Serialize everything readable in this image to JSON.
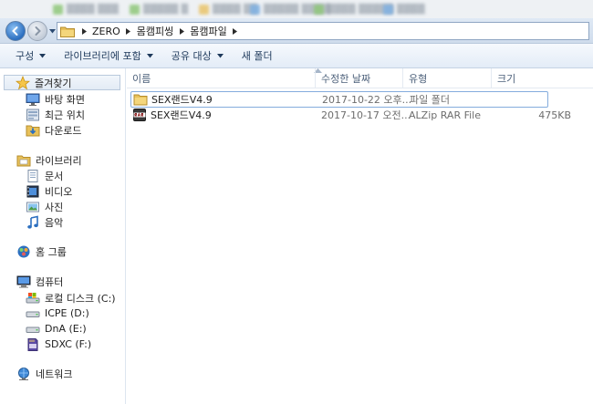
{
  "window": {
    "breadcrumb": [
      "ZERO",
      "몸캠피씽",
      "몸캠파일"
    ]
  },
  "toolbar": {
    "organize": "구성",
    "include_in_library": "라이브러리에 포함",
    "share_with": "공유 대상",
    "new_folder": "새 폴더"
  },
  "sidebar": {
    "favorites": {
      "header": "즐겨찾기",
      "items": [
        {
          "label": "바탕 화면",
          "icon": "desktop-icon"
        },
        {
          "label": "최근 위치",
          "icon": "recent-places-icon"
        },
        {
          "label": "다운로드",
          "icon": "downloads-icon"
        }
      ]
    },
    "libraries": {
      "header": "라이브러리",
      "items": [
        {
          "label": "문서",
          "icon": "documents-icon"
        },
        {
          "label": "비디오",
          "icon": "videos-icon"
        },
        {
          "label": "사진",
          "icon": "pictures-icon"
        },
        {
          "label": "음악",
          "icon": "music-icon"
        }
      ]
    },
    "homegroup": {
      "header": "홈 그룹"
    },
    "computer": {
      "header": "컴퓨터",
      "items": [
        {
          "label": "로컬 디스크 (C:)",
          "icon": "local-disk-icon"
        },
        {
          "label": "ICPE (D:)",
          "icon": "drive-icon"
        },
        {
          "label": "DnA (E:)",
          "icon": "drive-icon"
        },
        {
          "label": "SDXC (F:)",
          "icon": "sd-card-icon"
        }
      ]
    },
    "network": {
      "header": "네트워크"
    }
  },
  "columns": {
    "name": "이름",
    "date_modified": "수정한 날짜",
    "type": "유형",
    "size": "크기"
  },
  "files": [
    {
      "name": "SEX랜드V4.9",
      "date": "2017-10-22 오후...",
      "type": "파일 폴더",
      "size": "",
      "icon": "folder-icon"
    },
    {
      "name": "SEX랜드V4.9",
      "date": "2017-10-17 오전...",
      "type": "ALZip RAR File",
      "size": "475KB",
      "icon": "rar-archive-icon"
    }
  ],
  "colors": {
    "accent": "#3a78c3",
    "selection_border": "#84acdd",
    "folder": "#e8c15a",
    "column_header_text": "#4c607a"
  }
}
